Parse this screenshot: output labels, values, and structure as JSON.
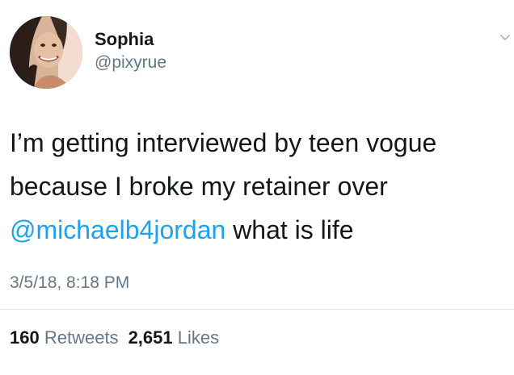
{
  "user": {
    "display_name": "Sophia",
    "handle": "@pixyrue"
  },
  "tweet": {
    "text_part1": "I’m getting interviewed by teen vogue because I broke my retainer over ",
    "mention": "@michaelb4jordan",
    "text_part2": " what is life",
    "timestamp": "3/5/18, 8:18 PM"
  },
  "stats": {
    "retweets_count": "160",
    "retweets_label": "Retweets",
    "likes_count": "2,651",
    "likes_label": "Likes"
  },
  "icons": {
    "menu": "chevron-down-icon"
  },
  "colors": {
    "link": "#1da1f2",
    "secondary_text": "#657786",
    "primary_text": "#14171a",
    "divider": "#e1e8ed"
  }
}
